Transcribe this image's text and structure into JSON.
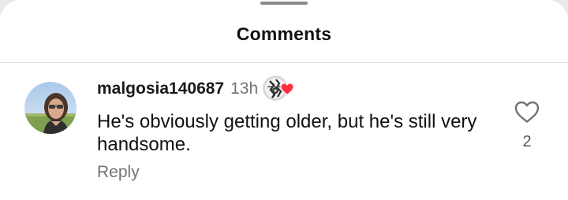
{
  "sheet": {
    "title": "Comments"
  },
  "comment": {
    "username": "malgosia140687",
    "timestamp": "13h",
    "text": "He's obviously getting older, but he's still very handsome.",
    "reply_label": "Reply",
    "like_count": "2",
    "avatar_icon": "profile-photo-icon",
    "author_liked_icon": "author-liked-heart-icon",
    "like_icon": "heart-outline-icon"
  },
  "colors": {
    "heart_red": "#ff3040",
    "muted_text": "#737373",
    "primary_text": "#111111"
  }
}
